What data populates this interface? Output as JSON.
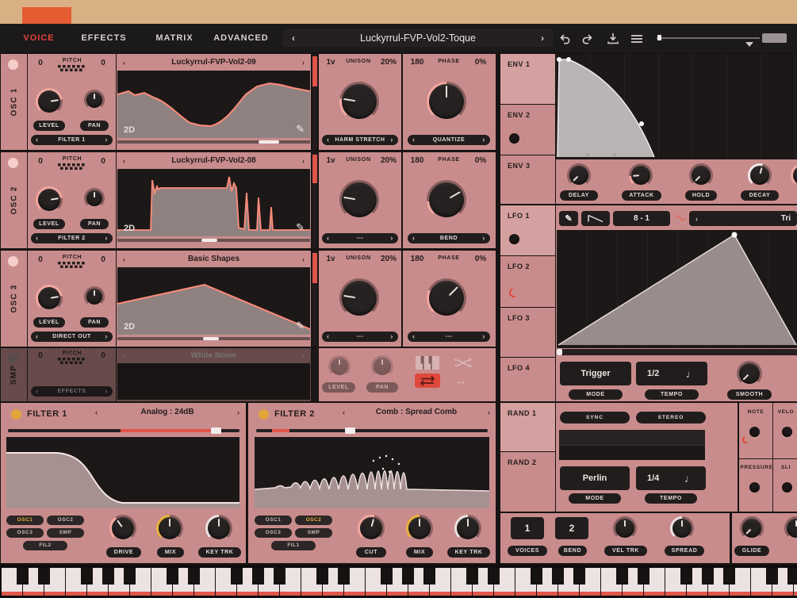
{
  "icons": {
    "pencil": "✎",
    "note": "♩",
    "left_right": "↔"
  },
  "header": {
    "tab_voice": "VOICE",
    "tab_effects": "EFFECTS",
    "tab_matrix": "MATRIX",
    "tab_advanced": "ADVANCED",
    "preset_name": "Luckyrrul-FVP-Vol2-Toque"
  },
  "oscs": [
    {
      "name": "OSC 1",
      "pitch_label": "PITCH",
      "transpose": "0",
      "tune": "0",
      "level_label": "LEVEL",
      "pan_label": "PAN",
      "routing": "FILTER 1",
      "wavetable": "Luckyrrul-FVP-Vol2-09",
      "view_mode": "2D",
      "unison_voices": "1v",
      "unison_label": "UNISON",
      "unison_detune": "20%",
      "phase_value": "180",
      "phase_label": "PHASE",
      "phase_rand": "0%",
      "dropdown_left": "HARM STRETCH",
      "dropdown_right": "QUANTIZE"
    },
    {
      "name": "OSC 2",
      "pitch_label": "PITCH",
      "transpose": "0",
      "tune": "0",
      "level_label": "LEVEL",
      "pan_label": "PAN",
      "routing": "FILTER 2",
      "wavetable": "Luckyrrul-FVP-Vol2-08",
      "view_mode": "2D",
      "unison_voices": "1v",
      "unison_label": "UNISON",
      "unison_detune": "20%",
      "phase_value": "180",
      "phase_label": "PHASE",
      "phase_rand": "0%",
      "dropdown_left": "---",
      "dropdown_right": "BEND"
    },
    {
      "name": "OSC 3",
      "pitch_label": "PITCH",
      "transpose": "0",
      "tune": "0",
      "level_label": "LEVEL",
      "pan_label": "PAN",
      "routing": "DIRECT OUT",
      "wavetable": "Basic Shapes",
      "view_mode": "2D",
      "unison_voices": "1v",
      "unison_label": "UNISON",
      "unison_detune": "20%",
      "phase_value": "180",
      "phase_label": "PHASE",
      "phase_rand": "0%",
      "dropdown_left": "---",
      "dropdown_right": "---"
    }
  ],
  "smp": {
    "name": "SMP",
    "pitch_label": "PITCH",
    "transpose": "0",
    "tune": "0",
    "sample_name": "White Noise",
    "level_label": "LEVEL",
    "pan_label": "PAN",
    "routing": "EFFECTS"
  },
  "filter1": {
    "title": "FILTER 1",
    "model": "Analog : 24dB",
    "in1": "OSC1",
    "in2": "OSC2",
    "in3": "OSC3",
    "in4": "SMP",
    "in5": "FIL2",
    "k1": "DRIVE",
    "k2": "MIX",
    "k3": "KEY TRK"
  },
  "filter2": {
    "title": "FILTER 2",
    "model": "Comb : Spread Comb",
    "in1": "OSC1",
    "in2": "OSC2",
    "in3": "OSC3",
    "in4": "SMP",
    "in5": "FIL1",
    "k1": "CUT",
    "k2": "MIX",
    "k3": "KEY TRK"
  },
  "env": {
    "tab1": "ENV 1",
    "tab2": "ENV 2",
    "tab3": "ENV 3",
    "k1": "DELAY",
    "k2": "ATTACK",
    "k3": "HOLD",
    "k4": "DECAY"
  },
  "lfo": {
    "tab1": "LFO 1",
    "tab2": "LFO 2",
    "tab3": "LFO 3",
    "tab4": "LFO 4",
    "steps": "8 - 1",
    "shape": "Tri",
    "mode": "Trigger",
    "mode_label": "MODE",
    "tempo": "1/2",
    "tempo_label": "TEMPO",
    "smooth_label": "SMOOTH"
  },
  "rand": {
    "tab1": "RAND 1",
    "tab2": "RAND 2",
    "sync": "SYNC",
    "stereo": "STEREO",
    "mode": "Perlin",
    "mode_label": "MODE",
    "tempo": "1/4",
    "tempo_label": "TEMPO"
  },
  "mods": {
    "note": "NOTE",
    "velocity": "VELO",
    "pressure": "PRESSURE",
    "slide": "SLI"
  },
  "voice": {
    "voices": "1",
    "voices_label": "VOICES",
    "bend": "2",
    "bend_label": "BEND",
    "vel_trk": "VEL TRK",
    "spread": "SPREAD",
    "glide": "GLIDE"
  }
}
